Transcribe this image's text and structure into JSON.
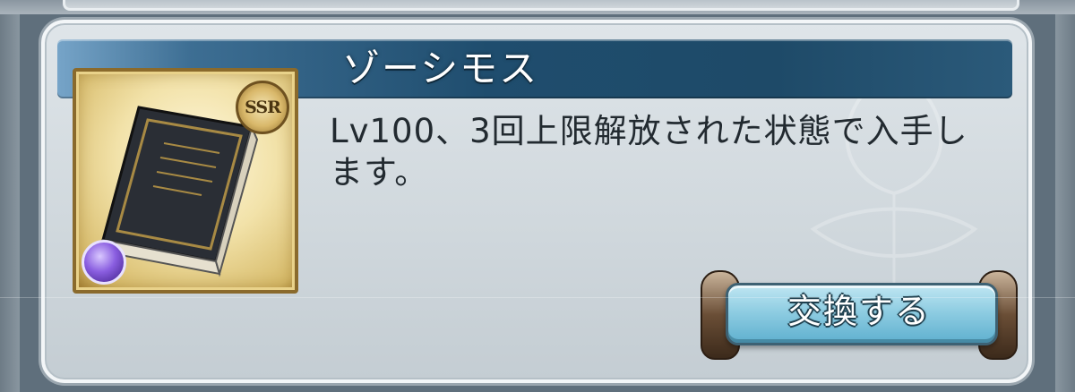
{
  "item": {
    "name": "ゾーシモス",
    "rarity": "SSR",
    "description": "Lv100、3回上限解放された状態で入手します。"
  },
  "actions": {
    "exchange_label": "交換する"
  },
  "colors": {
    "title_bar": "#1f4d6e",
    "button": "#8fcde2",
    "card_bg": "#d6dde2",
    "frame_gold": "#d7bb6a",
    "element_dark": "#8a5ee0"
  },
  "icons": {
    "item": "grimoire-book-icon",
    "rarity": "ssr-badge-icon",
    "element": "dark-element-icon"
  }
}
